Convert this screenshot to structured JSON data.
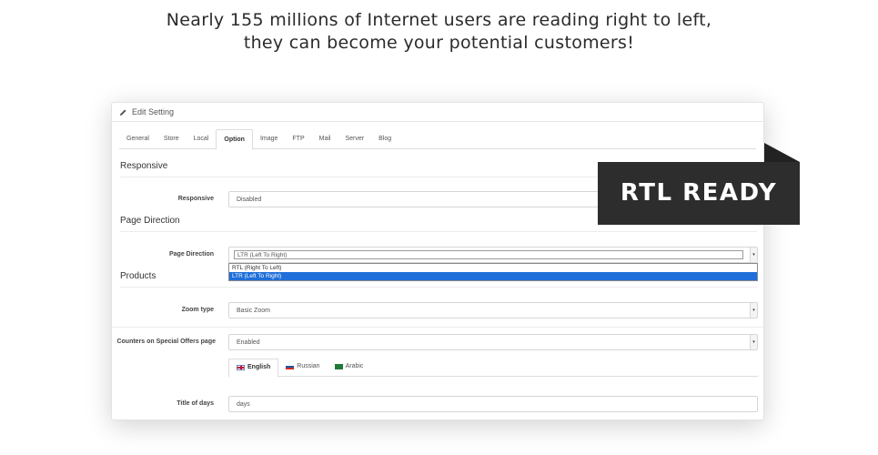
{
  "headline": {
    "line1": "Nearly 155 millions of Internet users are reading right to left,",
    "line2": "they can become your potential customers!"
  },
  "panel": {
    "title": "Edit Setting",
    "title_icon": "pencil-icon",
    "tabs": [
      "General",
      "Store",
      "Local",
      "Option",
      "Image",
      "FTP",
      "Mail",
      "Server",
      "Blog"
    ],
    "active_tab": "Option"
  },
  "sections": {
    "responsive": {
      "heading": "Responsive",
      "label": "Responsive",
      "value": "Disabled"
    },
    "page_direction": {
      "heading": "Page Direction",
      "label": "Page Direction",
      "value": "LTR (Left To Right)",
      "options": [
        "RTL (Right To Left)",
        "LTR (Left To Right)"
      ],
      "highlighted_option": "LTR (Left To Right)"
    },
    "products": {
      "heading": "Products",
      "zoom_label": "Zoom type",
      "zoom_value": "Basic Zoom",
      "counters_label": "Counters on Special Offers page",
      "counters_value": "Enabled",
      "languages": [
        "English",
        "Russian",
        "Arabic"
      ],
      "active_language": "English",
      "title_days_label": "Title of days",
      "title_days_value": "days"
    }
  },
  "badge": {
    "text": "RTL READY",
    "color": "#2d2d2d"
  },
  "colors": {
    "highlight": "#1e6fd9"
  }
}
